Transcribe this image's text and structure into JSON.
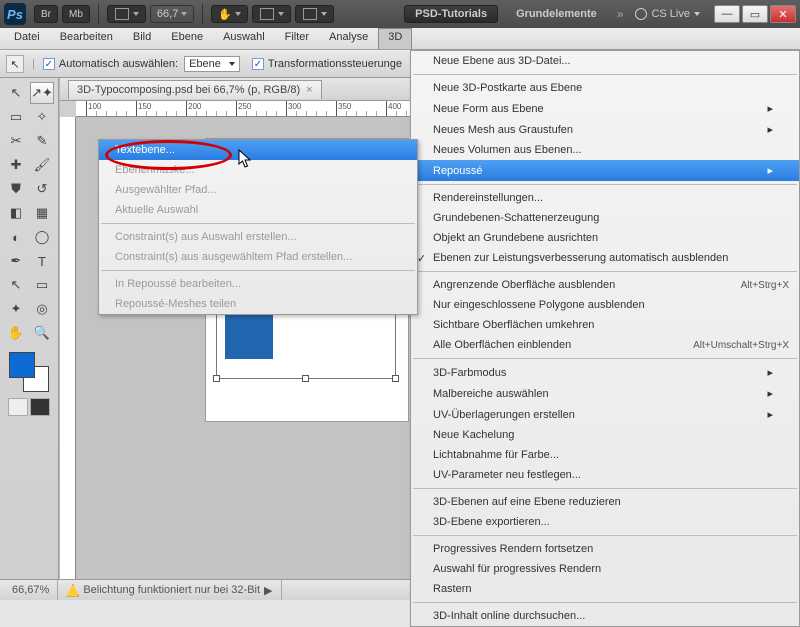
{
  "titlebar": {
    "ps_logo": "Ps",
    "br": "Br",
    "mb": "Mb",
    "zoom": "66,7",
    "hand_icon": "hand",
    "doc_icon": "doc",
    "screen_icon": "screen",
    "workspace_active": "PSD-Tutorials",
    "workspace_text": "Grundelemente",
    "chevron": "»",
    "cslive": "CS Live",
    "win_min": "—",
    "win_max": "▭",
    "win_close": "✕"
  },
  "menubar": {
    "items": [
      "Datei",
      "Bearbeiten",
      "Bild",
      "Ebene",
      "Auswahl",
      "Filter",
      "Analyse",
      "3D"
    ],
    "active_index": 7
  },
  "optionbar": {
    "auto_select_label": "Automatisch auswählen:",
    "auto_select_value": "Ebene",
    "transform_label": "Transformationssteuerunge",
    "checked_icon": "✓"
  },
  "doctab": {
    "title": "3D-Typocomposing.psd bei 66,7% (p, RGB/8)",
    "close": "×"
  },
  "ruler": {
    "ticks": [
      "100",
      "150",
      "200",
      "250",
      "300",
      "350",
      "400"
    ]
  },
  "menu3d": {
    "items": [
      {
        "label": "Neue Ebene aus 3D-Datei...",
        "type": "item"
      },
      {
        "type": "sep"
      },
      {
        "label": "Neue 3D-Postkarte aus Ebene",
        "type": "item"
      },
      {
        "label": "Neue Form aus Ebene",
        "type": "arrow"
      },
      {
        "label": "Neues Mesh aus Graustufen",
        "type": "arrow"
      },
      {
        "label": "Neues Volumen aus Ebenen...",
        "type": "item"
      },
      {
        "label": "Repoussé",
        "type": "arrow",
        "hi": true
      },
      {
        "type": "sep"
      },
      {
        "label": "Rendereinstellungen...",
        "type": "item"
      },
      {
        "label": "Grundebenen-Schattenerzeugung",
        "type": "item"
      },
      {
        "label": "Objekt an Grundebene ausrichten",
        "type": "item"
      },
      {
        "label": "Ebenen zur Leistungsverbesserung automatisch ausblenden",
        "type": "item",
        "checked": true
      },
      {
        "type": "sep"
      },
      {
        "label": "Angrenzende Oberfläche ausblenden",
        "shortcut": "Alt+Strg+X",
        "type": "item"
      },
      {
        "label": "Nur eingeschlossene Polygone ausblenden",
        "type": "item"
      },
      {
        "label": "Sichtbare Oberflächen umkehren",
        "type": "item"
      },
      {
        "label": "Alle Oberflächen einblenden",
        "shortcut": "Alt+Umschalt+Strg+X",
        "type": "item"
      },
      {
        "type": "sep"
      },
      {
        "label": "3D-Farbmodus",
        "type": "arrow"
      },
      {
        "label": "Malbereiche auswählen",
        "type": "arrow"
      },
      {
        "label": "UV-Überlagerungen erstellen",
        "type": "arrow"
      },
      {
        "label": "Neue Kachelung",
        "type": "item"
      },
      {
        "label": "Lichtabnahme für Farbe...",
        "type": "item"
      },
      {
        "label": "UV-Parameter neu festlegen...",
        "type": "item"
      },
      {
        "type": "sep"
      },
      {
        "label": "3D-Ebenen auf eine Ebene reduzieren",
        "type": "item"
      },
      {
        "label": "3D-Ebene exportieren...",
        "type": "item"
      },
      {
        "type": "sep"
      },
      {
        "label": "Progressives Rendern fortsetzen",
        "type": "item"
      },
      {
        "label": "Auswahl für progressives Rendern",
        "type": "item"
      },
      {
        "label": "Rastern",
        "type": "item"
      },
      {
        "type": "sep"
      },
      {
        "label": "3D-Inhalt online durchsuchen...",
        "type": "item"
      }
    ]
  },
  "submenu": {
    "items": [
      {
        "label": "Textebene...",
        "hi": true
      },
      {
        "label": "Ebenenmaske...",
        "dis": true
      },
      {
        "label": "Ausgewählter Pfad...",
        "dis": true
      },
      {
        "label": "Aktuelle Auswahl",
        "dis": true
      },
      {
        "type": "sep"
      },
      {
        "label": "Constraint(s) aus Auswahl erstellen...",
        "dis": true
      },
      {
        "label": "Constraint(s) aus ausgewähltem Pfad erstellen...",
        "dis": true
      },
      {
        "type": "sep"
      },
      {
        "label": "In Repoussé bearbeiten...",
        "dis": true
      },
      {
        "label": "Repoussé-Meshes teilen",
        "dis": true
      }
    ]
  },
  "statusbar": {
    "zoom": "66,67%",
    "warning": "Belichtung funktioniert nur bei 32-Bit"
  },
  "colors": {
    "accent": "#1e63c4",
    "letter": "#2067b0",
    "highlight": "#3b8de8"
  }
}
